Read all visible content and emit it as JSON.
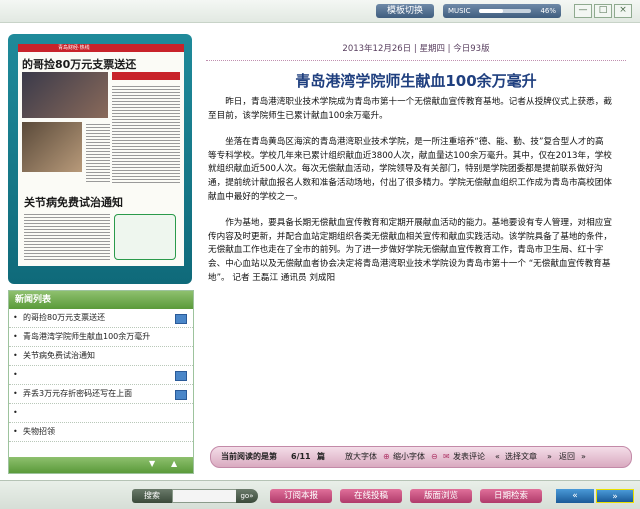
{
  "topbar": {
    "template_switch": "模板切换",
    "music_label": "MUSIC",
    "music_volume_pct": 46,
    "music_volume_text": "46%",
    "minimize": "—",
    "maximize": "□",
    "close": "×"
  },
  "thumbnail": {
    "masthead": "青岛财经·热线",
    "headline": "的哥捡80万元支票送还",
    "headline2": "关节病免费试治通知"
  },
  "news_list": {
    "header": "新闻列表",
    "bullet": "•",
    "items": [
      {
        "text": "的哥捡80万元支票送还",
        "has_icon": true
      },
      {
        "text": "青岛港湾学院师生献血100余万毫升",
        "has_icon": false
      },
      {
        "text": "关节病免费试治通知",
        "has_icon": false
      },
      {
        "text": "",
        "has_icon": true
      },
      {
        "text": "弄丢3万元存折密码还写在上面",
        "has_icon": true
      },
      {
        "text": "",
        "has_icon": false
      },
      {
        "text": "失物招领",
        "has_icon": false
      }
    ]
  },
  "article": {
    "date": "2013年12月26日",
    "weekday": "星期四",
    "edition": "今日93版",
    "separator": "|",
    "title": "青岛港湾学院师生献血100余万毫升",
    "paragraphs": [
      "昨日，青岛港湾职业技术学院成为青岛市第十一个无偿献血宣传教育基地。记者从授牌仪式上获悉，截至目前，该学院师生已累计献血100余万毫升。",
      "坐落在青岛黄岛区海滨的青岛港湾职业技术学院，是一所注重培养“德、能、勤、技”复合型人才的高等专科学校。学校几年来已累计组织献血近3800人次，献血量达100余万毫升。其中，仅在2013年，学校就组织献血近500人次。每次无偿献血活动，学院领导及有关部门，特别是学院团委都是提前联系做好沟通，提前统计献血报名人数和准备活动场地，付出了很多精力。学院无偿献血组织工作成为青岛市高校团体献血中最好的学校之一。",
      "作为基地，要具备长期无偿献血宣传教育和定期开展献血活动的能力。基地要设有专人管理，对相应宣传内容及时更新，并配合血站定期组织各类无偿献血相关宣传和献血实践活动。该学院具备了基地的条件，无偿献血工作也走在了全市的前列。为了进一步做好学院无偿献血宣传教育工作，青岛市卫生局、红十字会、中心血站以及无偿献血者协会决定将青岛港湾职业技术学院设为青岛市第十一个 “无偿献血宣传教育基地”。 记者 王磊江 通讯员 刘成阳"
    ]
  },
  "reading_bar": {
    "current_prefix": "当前阅读的是第",
    "current_page": "6/11",
    "current_suffix": "篇",
    "font_larger": "放大字体",
    "font_smaller": "缩小字体",
    "comment": "发表评论",
    "select_article": "选择文章",
    "back": "返回"
  },
  "footer": {
    "search_label": "搜索",
    "search_value": "",
    "search_go": "go»",
    "subscribe": "订阅本报",
    "submit": "在线投稿",
    "layout_view": "版面浏览",
    "date_search": "日期检索",
    "prev": "«",
    "next": "»"
  }
}
